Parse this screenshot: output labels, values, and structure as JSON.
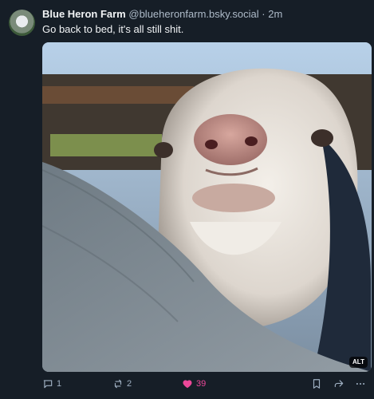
{
  "post": {
    "author_name": "Blue Heron Farm",
    "author_handle": "@blueheronfarm.bsky.social",
    "separator": "·",
    "time": "2m",
    "text": "Go back to bed, it's all still shit.",
    "image_alt_badge": "ALT"
  },
  "actions": {
    "reply_count": "1",
    "repost_count": "2",
    "like_count": "39"
  },
  "colors": {
    "background": "#161e27",
    "muted_text": "#aebbc9",
    "like_accent": "#ec4899"
  },
  "icons": [
    "avatar",
    "reply-icon",
    "repost-icon",
    "like-heart-icon",
    "bookmark-icon",
    "share-icon",
    "more-icon"
  ]
}
